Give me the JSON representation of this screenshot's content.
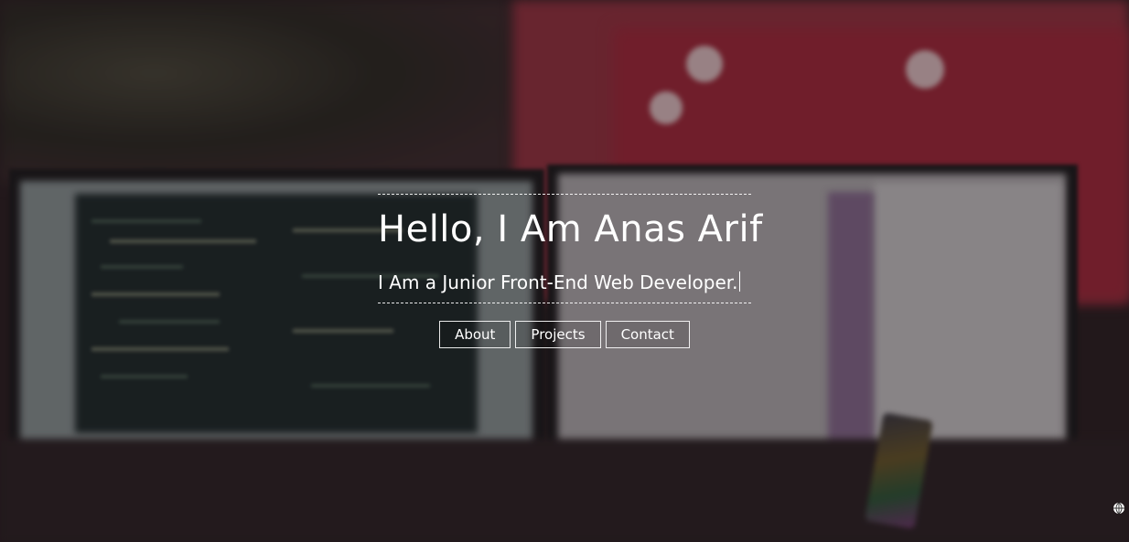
{
  "hero": {
    "title": "Hello, I Am Anas Arif",
    "subtitle": "I Am a Junior Front-End Web Developer."
  },
  "nav": {
    "items": [
      {
        "label": "About"
      },
      {
        "label": "Projects"
      },
      {
        "label": "Contact"
      }
    ]
  },
  "icons": {
    "corner": "globe-icon"
  },
  "colors": {
    "text": "#ffffff",
    "wall_accent": "#a8293c"
  }
}
